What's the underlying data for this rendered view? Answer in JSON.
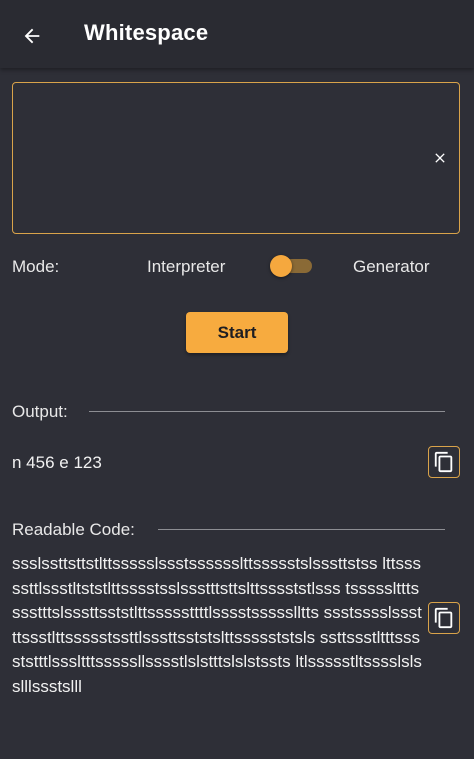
{
  "appbar": {
    "title": "Whitespace",
    "back_icon": "arrow-left-icon"
  },
  "input": {
    "value": "",
    "placeholder": "",
    "clear_icon": "close-icon"
  },
  "mode": {
    "label": "Mode:",
    "left_option": "Interpreter",
    "right_option": "Generator",
    "toggle_on": false
  },
  "start_button": {
    "label": "Start"
  },
  "output": {
    "label": "Output:",
    "value": "n 456 e 123",
    "copy_icon": "copy-icon"
  },
  "readable_code": {
    "label": "Readable Code:",
    "value": "ssslssttsttstlttssssslssstsssssslttssssstslsssttstss lttsssssttlssstltststlttsssstsslssstttsttslttsssststlsss tsssssltttsssstttslsssttsststlttsssssttttlsssstssssslltts ssstsssslssstttssstlttssssstssttlsssttsststslttssssststsls ssttssstltttsssststttlsssltttsssssllsssstlslstttslslstssts ltlssssstltsssslslsslllssstslll",
    "copy_icon": "copy-icon"
  },
  "colors": {
    "background": "#2e2f37",
    "appbar": "#2a2b32",
    "accent": "#f7ab3f",
    "border_accent": "#d9a34a"
  }
}
